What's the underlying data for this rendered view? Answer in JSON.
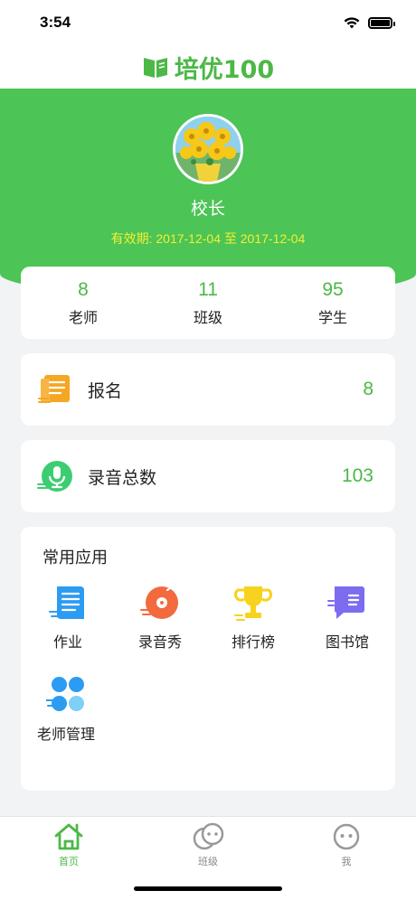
{
  "status_bar": {
    "time": "3:54"
  },
  "header": {
    "logo_text": "培优100"
  },
  "profile": {
    "name": "校长",
    "validity": "有效期: 2017-12-04 至 2017-12-04"
  },
  "stats": [
    {
      "value": "8",
      "label": "老师"
    },
    {
      "value": "11",
      "label": "班级"
    },
    {
      "value": "95",
      "label": "学生"
    }
  ],
  "signup": {
    "label": "报名",
    "value": "8"
  },
  "recordings": {
    "label": "录音总数",
    "value": "103"
  },
  "apps": {
    "title": "常用应用",
    "items": [
      {
        "label": "作业",
        "icon": "homework-icon"
      },
      {
        "label": "录音秀",
        "icon": "record-show-icon"
      },
      {
        "label": "排行榜",
        "icon": "trophy-icon"
      },
      {
        "label": "图书馆",
        "icon": "library-icon"
      },
      {
        "label": "老师管理",
        "icon": "teacher-management-icon"
      }
    ]
  },
  "tabbar": {
    "items": [
      {
        "label": "首页",
        "icon": "home-icon",
        "active": true
      },
      {
        "label": "班级",
        "icon": "class-icon",
        "active": false
      },
      {
        "label": "我",
        "icon": "profile-icon",
        "active": false
      }
    ]
  },
  "colors": {
    "brand_green": "#4cc456",
    "accent_text_green": "#4cb847",
    "validity_yellow": "#f5ef32"
  }
}
